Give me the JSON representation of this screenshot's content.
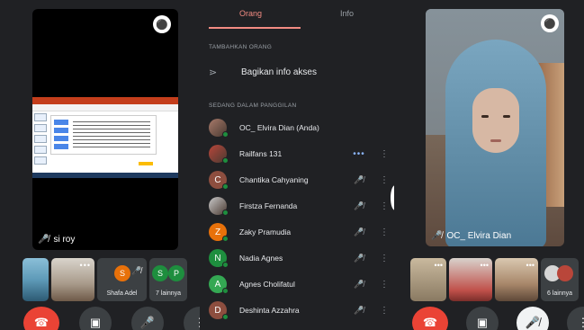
{
  "left": {
    "presenter_name": "si roy",
    "thumbs": [
      {
        "type": "avatar",
        "name": "Shafa Adel",
        "initial": "S",
        "color": "#e8710a"
      },
      {
        "type": "group",
        "label": "7 lainnya",
        "initials": [
          "S",
          "P"
        ],
        "colors": [
          "#1e8e3e",
          "#1e8e3e"
        ]
      }
    ]
  },
  "panel": {
    "tabs": {
      "people": "Orang",
      "info": "Info"
    },
    "add_people_heading": "TAMBAHKAN ORANG",
    "share_label": "Bagikan info akses",
    "in_call_heading": "SEDANG DALAM PANGGILAN",
    "participants": [
      {
        "name": "OC_ Elvira Dian (Anda)",
        "initial": "",
        "color": "#a87a6a",
        "photo": true,
        "mic": "",
        "more": ""
      },
      {
        "name": "Railfans 131",
        "initial": "",
        "color": "#b9463a",
        "photo": true,
        "mic": "•••",
        "more": "⋮"
      },
      {
        "name": "Chantika Cahyaning",
        "initial": "C",
        "color": "#8d4e3f",
        "photo": false,
        "mic": "mic-off",
        "more": "⋮"
      },
      {
        "name": "Firstza Fernanda",
        "initial": "",
        "color": "#c9c9c9",
        "photo": true,
        "mic": "mic-off",
        "more": "⋮"
      },
      {
        "name": "Zaky Pramudia",
        "initial": "Z",
        "color": "#e8710a",
        "photo": false,
        "mic": "mic-off",
        "more": "⋮"
      },
      {
        "name": "Nadia Agnes",
        "initial": "N",
        "color": "#1e8e3e",
        "photo": false,
        "mic": "mic-off",
        "more": "⋮"
      },
      {
        "name": "Agnes Cholifatul",
        "initial": "A",
        "color": "#34a853",
        "photo": false,
        "mic": "mic-off",
        "more": "⋮"
      },
      {
        "name": "Deshinta Azzahra",
        "initial": "D",
        "color": "#8d4e3f",
        "photo": false,
        "mic": "mic-off",
        "more": "⋮"
      }
    ]
  },
  "right": {
    "cam_name": "OC_ Elvira Dian",
    "others_label": "6 lainnya"
  },
  "icons": {
    "pin": "pin-icon",
    "mic_off": "mic-off-icon",
    "end_call": "end-call-icon",
    "camera": "camera-icon",
    "mic": "mic-icon",
    "more": "more-vert-icon",
    "share": "share-icon"
  },
  "colors": {
    "accent": "#f28b82",
    "end_call": "#ea4335",
    "bg": "#202124",
    "online": "#1e8e3e",
    "speaking": "#8ab4f8"
  }
}
